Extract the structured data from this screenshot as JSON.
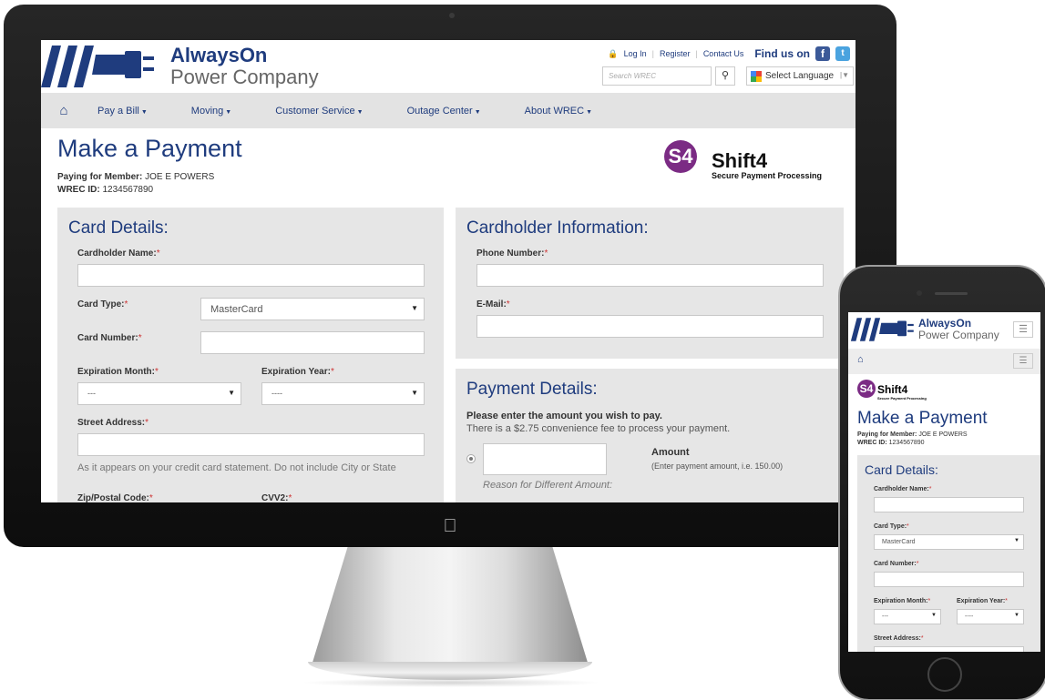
{
  "brand": {
    "name_top": "AlwaysOn",
    "name_bottom": "Power Company"
  },
  "toplinks": {
    "login": "Log In",
    "register": "Register",
    "contact": "Contact Us",
    "find_us": "Find us on",
    "facebook": "f",
    "twitter": "t"
  },
  "search": {
    "placeholder": "Search WREC",
    "button_icon": "search-icon"
  },
  "language": {
    "label": "Select Language"
  },
  "nav": {
    "items": [
      {
        "label": "Pay a Bill"
      },
      {
        "label": "Moving"
      },
      {
        "label": "Customer Service"
      },
      {
        "label": "Outage Center"
      },
      {
        "label": "About WREC"
      }
    ]
  },
  "page": {
    "title": "Make a Payment",
    "paying_label": "Paying for Member:",
    "paying_value": "JOE E POWERS",
    "id_label": "WREC ID:",
    "id_value": "1234567890"
  },
  "shift4": {
    "mark": "S4",
    "name": "Shift4",
    "tagline": "Secure Payment Processing"
  },
  "card_details": {
    "title": "Card Details:",
    "cardholder_name": "Cardholder Name:",
    "card_type": "Card Type:",
    "card_type_value": "MasterCard",
    "card_number": "Card Number:",
    "exp_month": "Expiration Month:",
    "exp_month_value": "---",
    "exp_year": "Expiration Year:",
    "exp_year_value": "----",
    "street": "Street Address:",
    "street_help": "As it appears on your credit card statement. Do not include City or State",
    "zip": "Zip/Postal Code:",
    "cvv": "CVV2:",
    "required_mark": "*"
  },
  "cardholder_info": {
    "title": "Cardholder Information:",
    "phone": "Phone Number:",
    "email": "E-Mail:"
  },
  "payment_details": {
    "title": "Payment Details:",
    "prompt": "Please enter the amount you wish to pay.",
    "fee_note": "There is a $2.75 convenience fee to process your payment.",
    "amount_label": "Amount",
    "amount_hint": "(Enter payment amount, i.e. 150.00)",
    "reason_label": "Reason for Different Amount:"
  },
  "colors": {
    "brand_blue": "#1f3c7e",
    "panel_gray": "#e6e6e6",
    "shift4_purple": "#7b2b84",
    "required_red": "#cc3333"
  }
}
